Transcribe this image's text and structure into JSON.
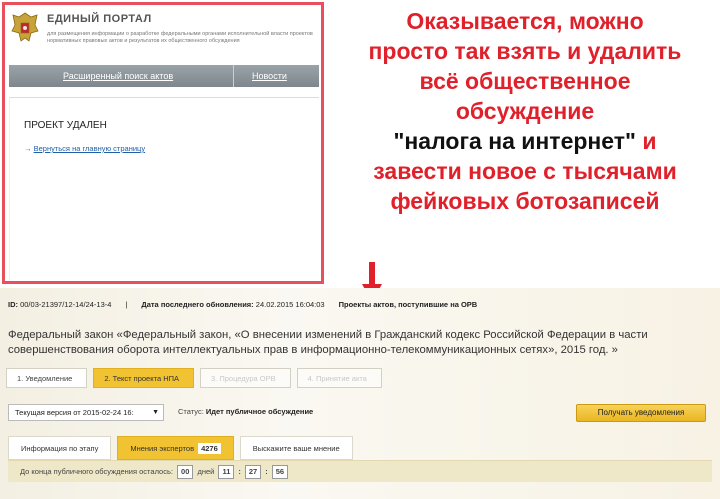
{
  "portal": {
    "title": "ЕДИНЫЙ ПОРТАЛ",
    "subtitle": "для размещения информации о разработке федеральными органами исполнительной власти проектов нормативных правовых актов и результатов их общественного обсуждения",
    "nav": {
      "advanced_search": "Расширенный поиск актов",
      "news": "Новости"
    },
    "deleted_title": "ПРОЕКТ УДАЛЕН",
    "back_arrow": "→",
    "back_link": "Вернуться на главную страницу"
  },
  "caption": {
    "line1": "Оказывается, можно",
    "line2": "просто так взять и удалить",
    "line3": "всё общественное",
    "line4": "обсуждение",
    "line5_quote": "\"налога на интернет\"",
    "line5_rest": " и",
    "line6": "завести новое с тысячами",
    "line7": "фейковых ботозаписей"
  },
  "project": {
    "id_label": "ID:",
    "id_value": "00/03-21397/12-14/24-13-4",
    "sep": "|",
    "updated_label": "Дата последнего обновления:",
    "updated_value": "24.02.2015 16:04:03",
    "category": "Проекты актов, поступившие на ОРВ",
    "title": "Федеральный закон «Федеральный закон, «О внесении изменений в Гражданский кодекс Российской Федерации в части совершенствования оборота интеллектуальных прав в информационно-телекоммуникационных сетях», 2015 год. »"
  },
  "steps": [
    {
      "label": "1. Уведомление",
      "state": "done"
    },
    {
      "label": "2. Текст проекта НПА",
      "state": "active"
    },
    {
      "label": "3. Процедура ОРВ",
      "state": "future"
    },
    {
      "label": "4. Принятие акта",
      "state": "future"
    }
  ],
  "toolbar": {
    "version_value": "Текущая версия от 2015-02-24 16:",
    "status_label": "Статус:",
    "status_value": "Идет публичное обсуждение",
    "notify_button": "Получать уведомления"
  },
  "tabs": [
    {
      "label": "Информация по этапу",
      "active": false
    },
    {
      "label": "Мнения экспертов",
      "count": "4276",
      "active": true
    },
    {
      "label": "Выскажите ваше мнение",
      "active": false
    }
  ],
  "timer": {
    "label": "До конца публичного обсуждения осталось:",
    "days": "00",
    "days_label": "дней",
    "hours": "11",
    "minutes": "27",
    "seconds": "56",
    "colon": ":"
  },
  "colors": {
    "accent": "#f1c232",
    "caption_red": "#e0202a",
    "frame_red": "#e8505e",
    "link": "#1f5fa8"
  }
}
